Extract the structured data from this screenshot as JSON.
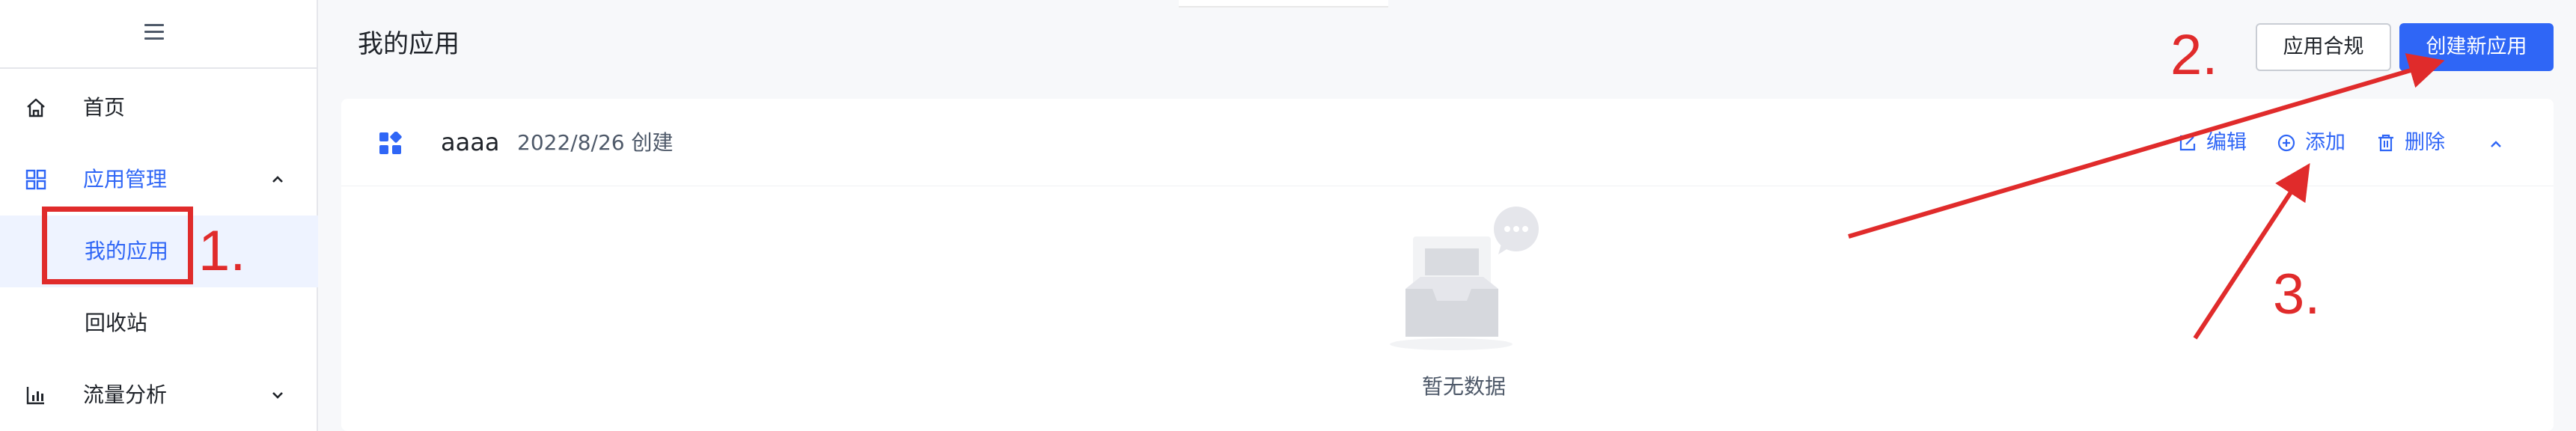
{
  "sidebar": {
    "items": [
      {
        "label": "首页",
        "icon": "home-icon"
      },
      {
        "label": "应用管理",
        "icon": "grid-icon",
        "expanded": true
      },
      {
        "label": "我的应用",
        "selected": true
      },
      {
        "label": "回收站"
      },
      {
        "label": "流量分析",
        "icon": "chart-icon",
        "expanded": false
      }
    ]
  },
  "header": {
    "title": "我的应用",
    "compliance_button": "应用合规",
    "create_button": "创建新应用"
  },
  "app_card": {
    "name": "aaaa",
    "created": "2022/8/26 创建",
    "actions": {
      "edit": "编辑",
      "add": "添加",
      "delete": "删除"
    },
    "empty_text": "暂无数据"
  },
  "annotations": {
    "step1": "1.",
    "step2": "2.",
    "step3": "3.",
    "color": "#e02b2b"
  },
  "colors": {
    "accent": "#2f66f6",
    "selected_bg": "#eef3ff"
  }
}
